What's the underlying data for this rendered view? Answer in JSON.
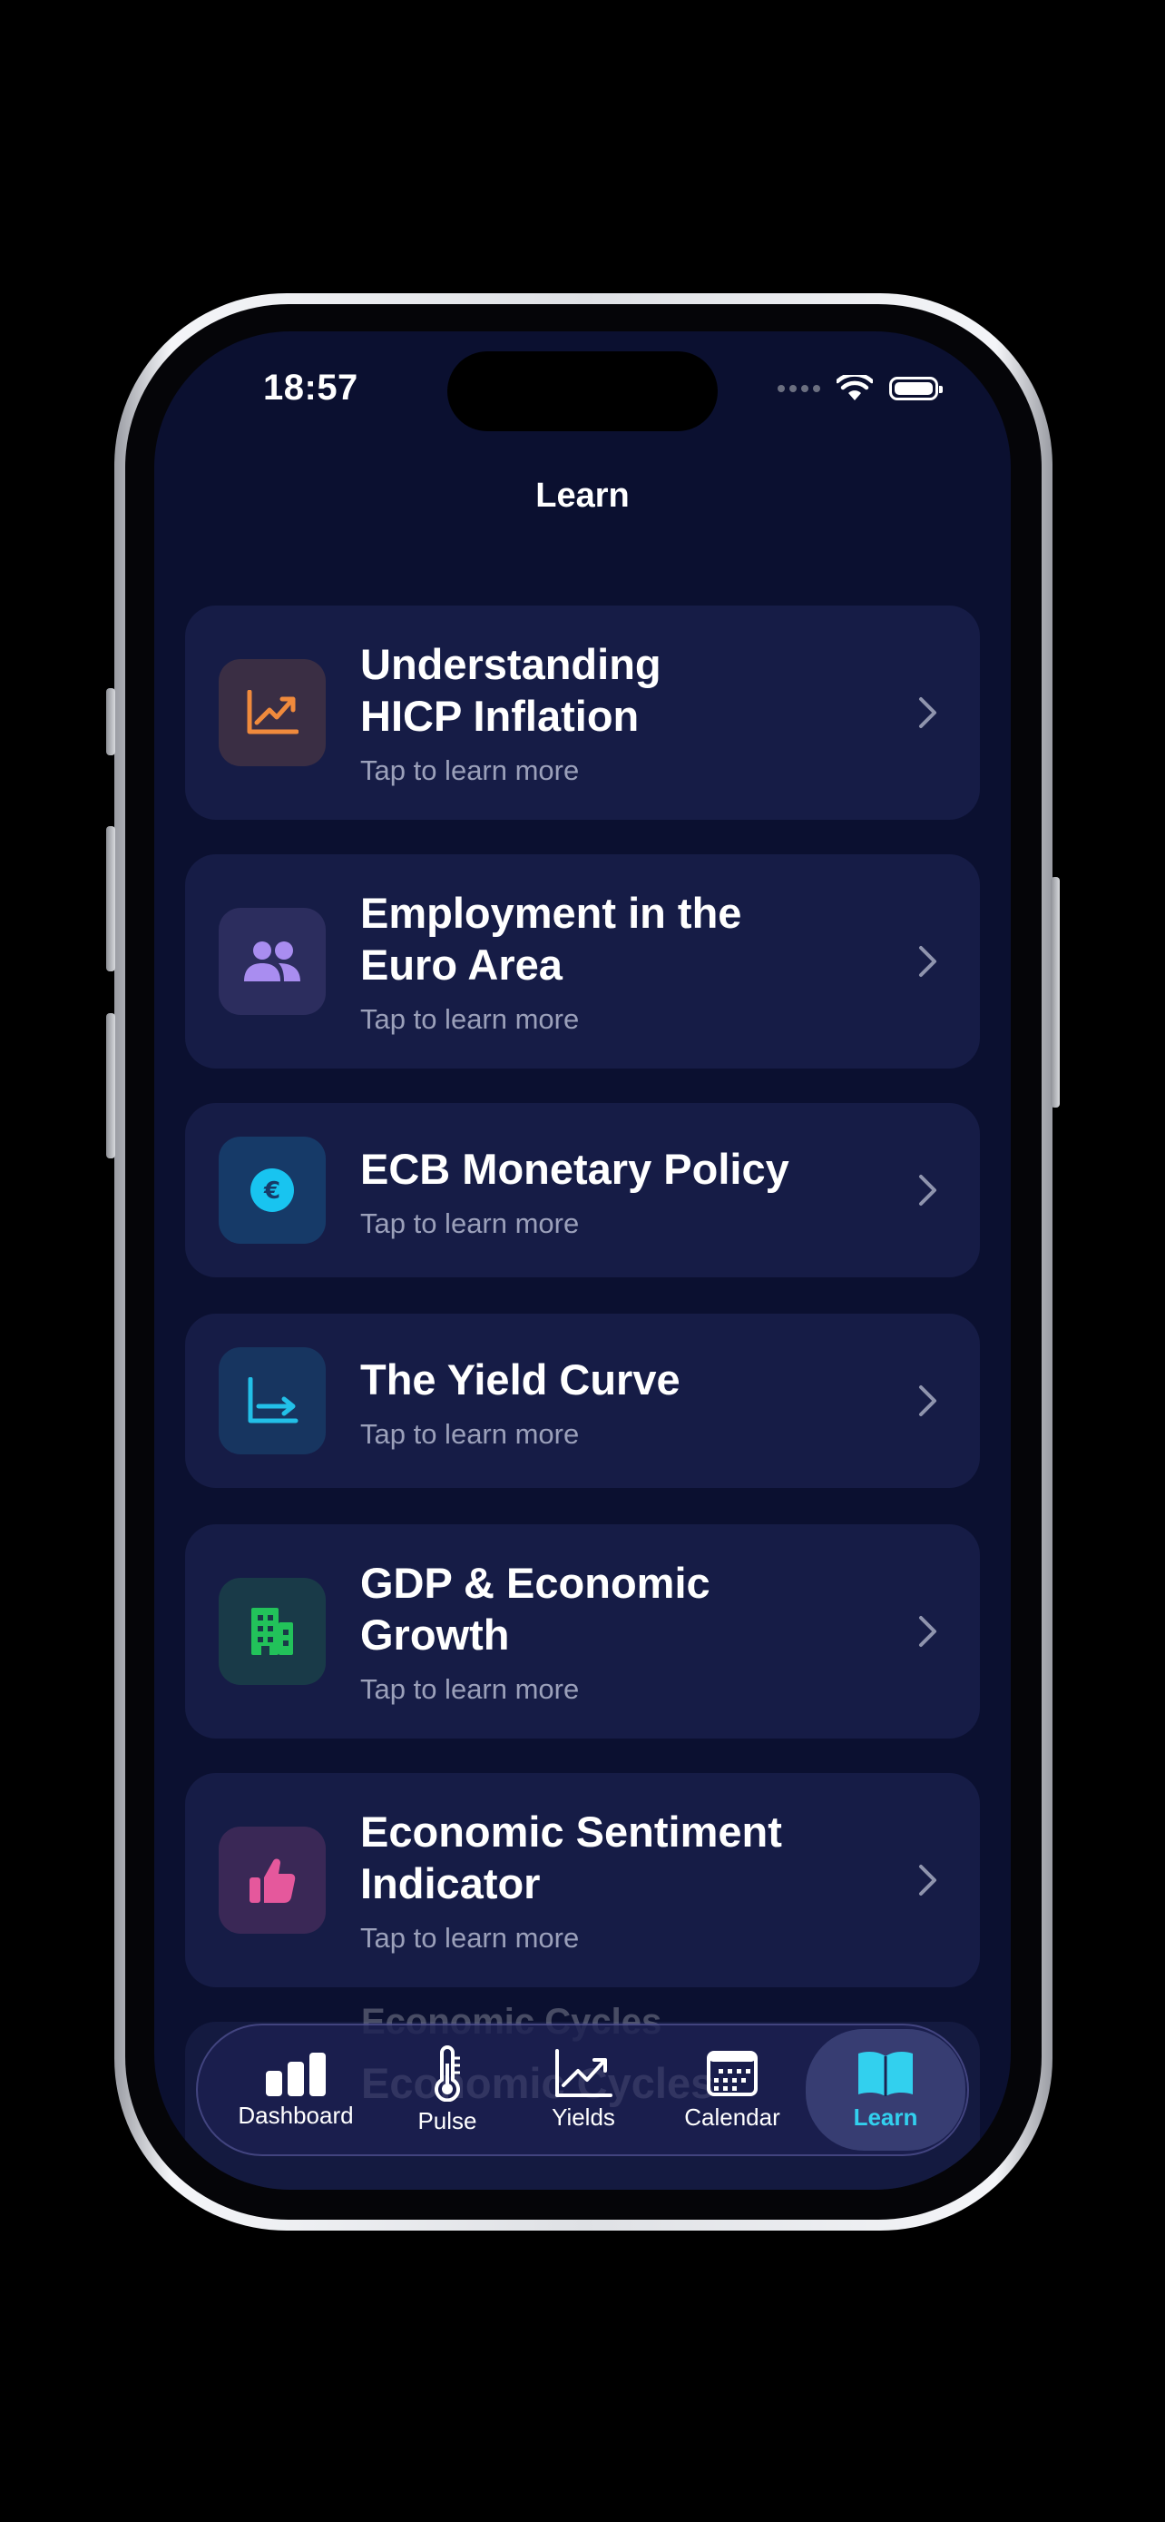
{
  "status_bar": {
    "time": "18:57"
  },
  "header": {
    "title": "Learn"
  },
  "cards": [
    {
      "title": "Understanding\nHICP Inflation",
      "subtitle": "Tap to learn more",
      "icon": "trend-chart-icon",
      "color": "#f08a3c"
    },
    {
      "title": "Employment in the\nEuro Area",
      "subtitle": "Tap to learn more",
      "icon": "people-icon",
      "color": "#a98df0"
    },
    {
      "title": "ECB Monetary Policy",
      "subtitle": "Tap to learn more",
      "icon": "euro-coin-icon",
      "color": "#18c4f0"
    },
    {
      "title": "The Yield Curve",
      "subtitle": "Tap to learn more",
      "icon": "yield-curve-icon",
      "color": "#22c0e8"
    },
    {
      "title": "GDP & Economic\nGrowth",
      "subtitle": "Tap to learn more",
      "icon": "building-icon",
      "color": "#22c25a"
    },
    {
      "title": "Economic Sentiment\nIndicator",
      "subtitle": "Tap to learn more",
      "icon": "thumbs-up-icon",
      "color": "#e5589c"
    }
  ],
  "partial_card": {
    "title": "Economic Cycles"
  },
  "tab_bar": {
    "items": [
      {
        "label": "Dashboard",
        "icon": "bar-chart-icon"
      },
      {
        "label": "Pulse",
        "icon": "thermometer-icon"
      },
      {
        "label": "Yields",
        "icon": "line-chart-icon"
      },
      {
        "label": "Calendar",
        "icon": "calendar-icon"
      },
      {
        "label": "Learn",
        "icon": "book-icon",
        "active": true
      }
    ]
  },
  "colors": {
    "background": "#0b1030",
    "card": "#161c46",
    "accent": "#32d0ee"
  }
}
